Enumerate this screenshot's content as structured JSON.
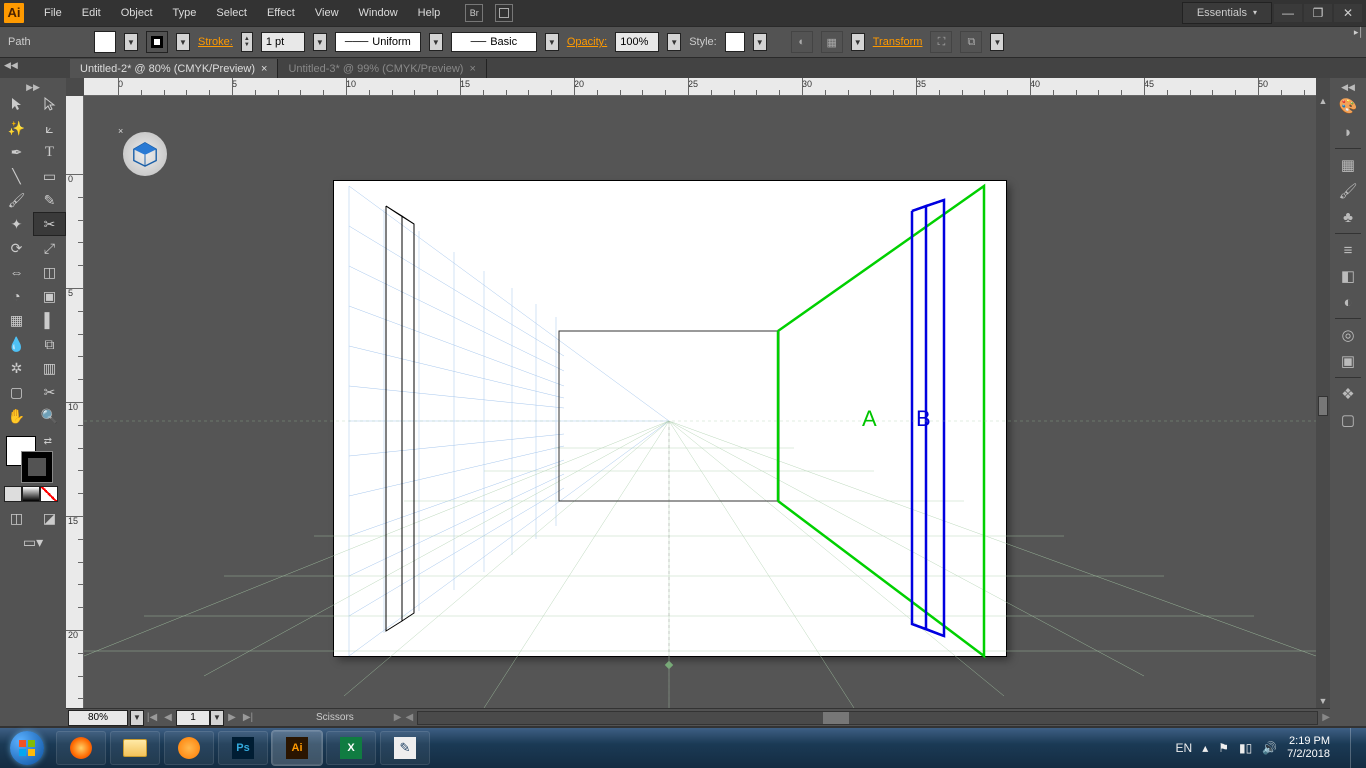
{
  "app": {
    "logo": "Ai"
  },
  "menu": [
    "File",
    "Edit",
    "Object",
    "Type",
    "Select",
    "Effect",
    "View",
    "Window",
    "Help"
  ],
  "workspace": "Essentials",
  "optbar": {
    "context": "Path",
    "stroke_label": "Stroke:",
    "stroke_weight": "1 pt",
    "brush_profile": "Uniform",
    "brush_def": "Basic",
    "opacity_label": "Opacity:",
    "opacity_value": "100%",
    "style_label": "Style:",
    "transform_label": "Transform"
  },
  "tabs": [
    {
      "label": "Untitled-2* @ 80% (CMYK/Preview)",
      "active": true
    },
    {
      "label": "Untitled-3* @ 99% (CMYK/Preview)",
      "active": false
    }
  ],
  "ruler_h": [
    "0",
    "5",
    "10",
    "15",
    "20",
    "25",
    "30",
    "35",
    "40",
    "45",
    "50"
  ],
  "ruler_v": [
    "0",
    "5",
    "1",
    "1",
    "2"
  ],
  "ruler_v_marks": [
    "0",
    "5",
    "10",
    "15",
    "20"
  ],
  "canvas": {
    "labelA": "A",
    "labelB": "B"
  },
  "docstatus": {
    "zoom": "80%",
    "page": "1",
    "tool": "Scissors"
  },
  "taskbar": {
    "lang": "EN",
    "time": "2:19 PM",
    "date": "7/2/2018"
  }
}
